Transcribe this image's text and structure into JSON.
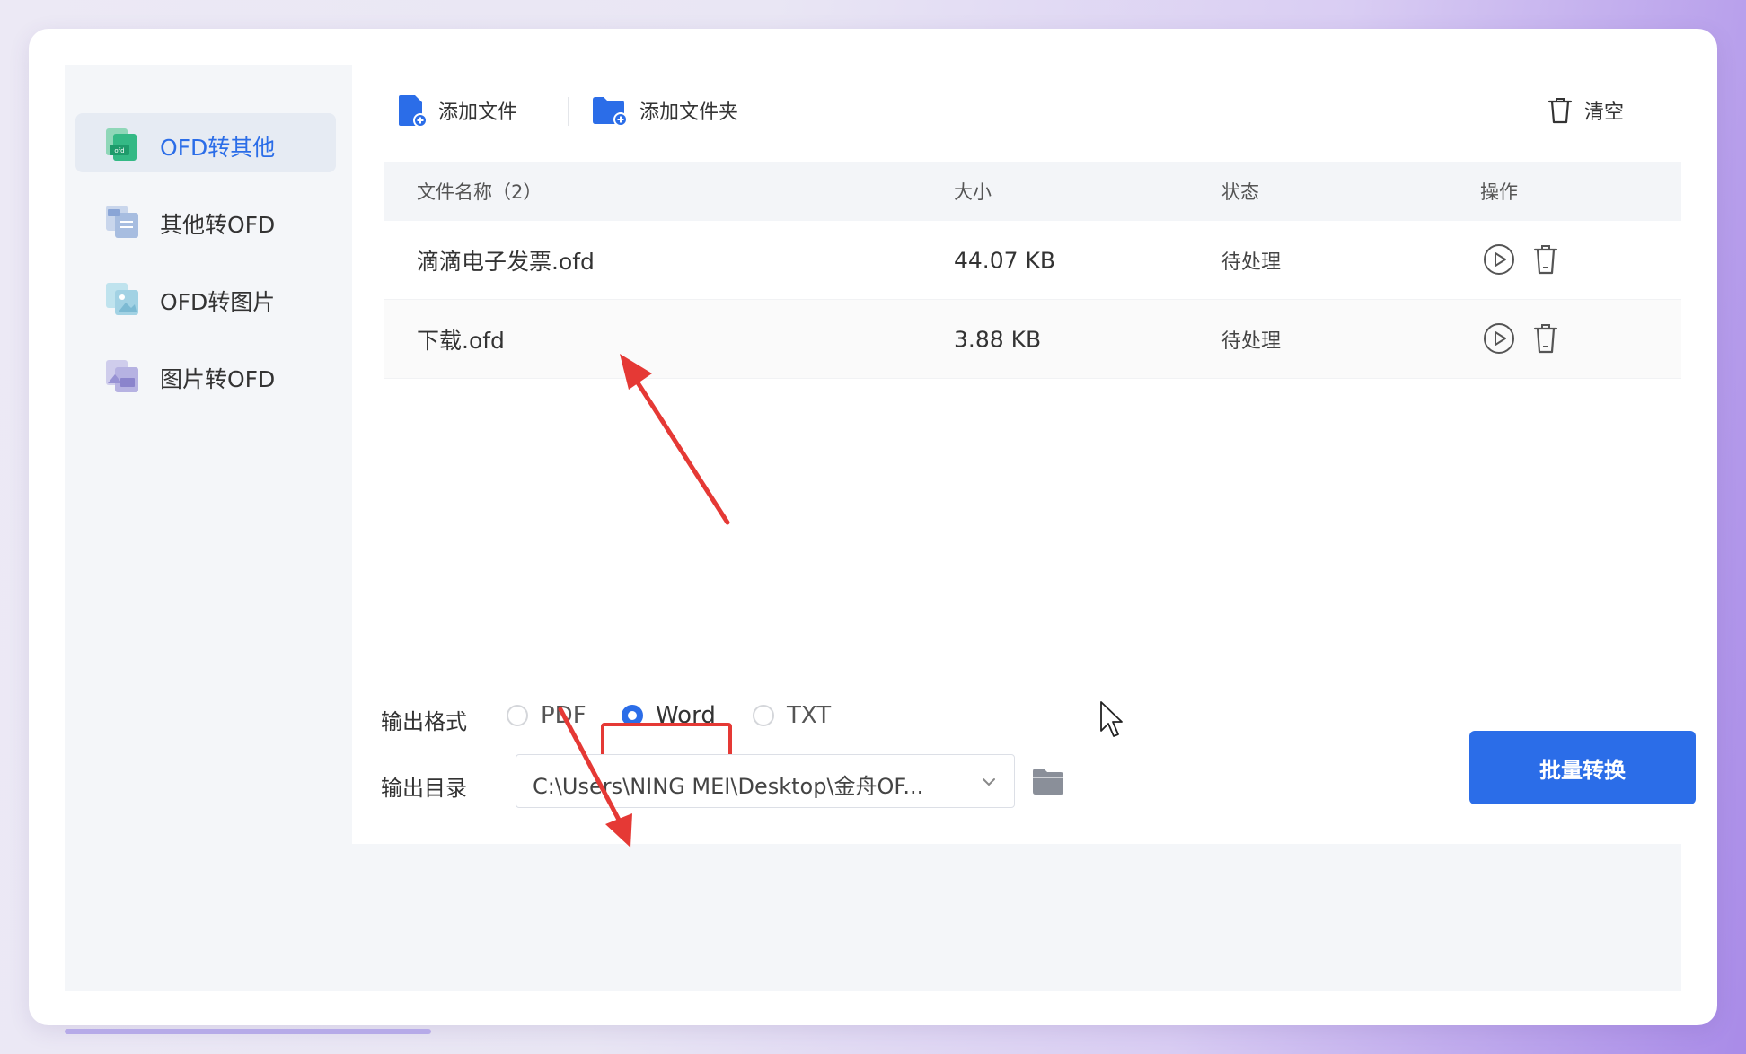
{
  "sidebar": {
    "items": [
      {
        "label": "OFD转其他",
        "icon": "ofd-to-other-icon",
        "active": true
      },
      {
        "label": "其他转OFD",
        "icon": "other-to-ofd-icon",
        "active": false
      },
      {
        "label": "OFD转图片",
        "icon": "ofd-to-image-icon",
        "active": false
      },
      {
        "label": "图片转OFD",
        "icon": "image-to-ofd-icon",
        "active": false
      }
    ]
  },
  "toolbar": {
    "add_file_label": "添加文件",
    "add_folder_label": "添加文件夹",
    "clear_label": "清空"
  },
  "table": {
    "headers": {
      "name": "文件名称（2）",
      "size": "大小",
      "status": "状态",
      "ops": "操作"
    },
    "rows": [
      {
        "name": "滴滴电子发票.ofd",
        "size": "44.07 KB",
        "status": "待处理"
      },
      {
        "name": "下载.ofd",
        "size": "3.88 KB",
        "status": "待处理"
      }
    ]
  },
  "output": {
    "format_label": "输出格式",
    "formats": [
      "PDF",
      "Word",
      "TXT"
    ],
    "selected_format": "Word",
    "dir_label": "输出目录",
    "dir_value": "C:\\Users\\NING MEI\\Desktop\\金舟OF..."
  },
  "convert_button_label": "批量转换",
  "colors": {
    "accent": "#2b6de8",
    "annotation": "#e53935",
    "sidebar_bg": "#f4f6f9"
  }
}
